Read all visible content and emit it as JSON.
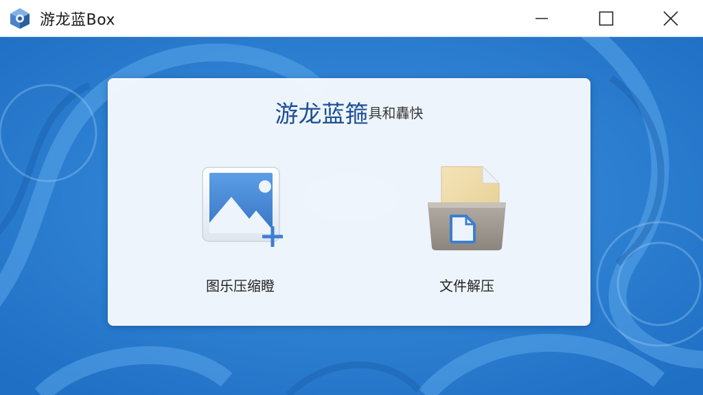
{
  "window": {
    "title": "游龙蓝Box",
    "app_icon": "app-logo-icon",
    "controls": [
      "minimize-icon",
      "maximize-icon",
      "close-icon"
    ]
  },
  "card": {
    "title_main": "游龙蓝箍",
    "title_sub": "具和轟快"
  },
  "tools": [
    {
      "label": "图乐压缩瞪",
      "icon": "image-add-icon"
    },
    {
      "label": "文件解压",
      "icon": "folder-file-icon"
    }
  ],
  "colors": {
    "background_blue": "#2a7fd3",
    "title_blue": "#1d4f94",
    "accent_blue": "#3b7fd0"
  }
}
